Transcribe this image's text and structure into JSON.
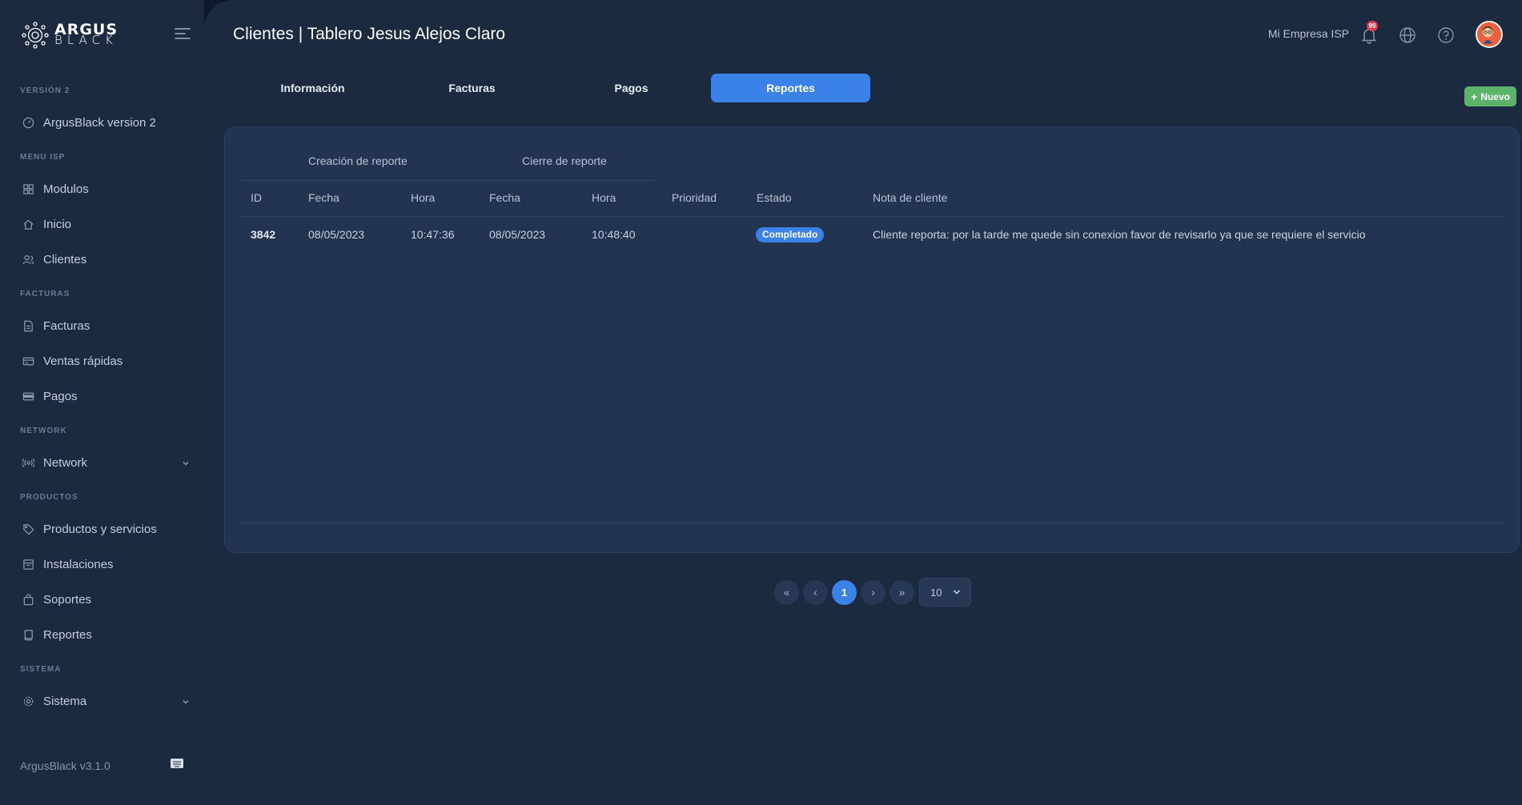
{
  "sidebar": {
    "logo": {
      "line1": "ARGUS",
      "line2": "BLACK"
    },
    "sections": [
      {
        "label": "VERSIÓN 2"
      },
      {
        "label": "MENU ISP"
      },
      {
        "label": "FACTURAS"
      },
      {
        "label": "NETWORK"
      },
      {
        "label": "PRODUCTOS"
      },
      {
        "label": "SISTEMA"
      }
    ],
    "items": [
      {
        "label": "ArgusBlack version 2",
        "icon": "gauge-icon"
      },
      {
        "label": "Modulos",
        "icon": "grid-icon"
      },
      {
        "label": "Inicio",
        "icon": "home-icon"
      },
      {
        "label": "Clientes",
        "icon": "users-icon"
      },
      {
        "label": "Facturas",
        "icon": "file-icon"
      },
      {
        "label": "Ventas rápidas",
        "icon": "card-icon"
      },
      {
        "label": "Pagos",
        "icon": "wallet-icon"
      },
      {
        "label": "Network",
        "icon": "broadcast-icon"
      },
      {
        "label": "Productos y servicios",
        "icon": "tag-icon"
      },
      {
        "label": "Instalaciones",
        "icon": "archive-icon"
      },
      {
        "label": "Soportes",
        "icon": "bag-icon"
      },
      {
        "label": "Reportes",
        "icon": "book-icon"
      },
      {
        "label": "Sistema",
        "icon": "gear-icon"
      }
    ],
    "footer_version": "ArgusBlack v3.1.0"
  },
  "header": {
    "title": "Clientes | Tablero Jesus Alejos Claro",
    "company": "Mi Empresa ISP",
    "notifications_count": "99"
  },
  "tabs": [
    {
      "label": "Información",
      "active": false
    },
    {
      "label": "Facturas",
      "active": false
    },
    {
      "label": "Pagos",
      "active": false
    },
    {
      "label": "Reportes",
      "active": true
    }
  ],
  "new_button": "Nuevo",
  "table": {
    "groups": [
      "Creación de reporte",
      "Cierre de reporte"
    ],
    "columns": [
      "ID",
      "Fecha",
      "Hora",
      "Fecha",
      "Hora",
      "Prioridad",
      "Estado",
      "Nota de cliente"
    ],
    "rows": [
      {
        "id": "3842",
        "fecha_creacion": "08/05/2023",
        "hora_creacion": "10:47:36",
        "fecha_cierre": "08/05/2023",
        "hora_cierre": "10:48:40",
        "prioridad": "",
        "estado": "Completado",
        "nota": "Cliente reporta: por la tarde me quede sin conexion favor de revisarlo ya que se requiere el servicio"
      }
    ]
  },
  "pagination": {
    "first": "«",
    "prev": "‹",
    "current": "1",
    "next": "›",
    "last": "»",
    "page_size": "10"
  },
  "colors": {
    "accent": "#3b82e8",
    "success": "#5cb36a",
    "badge": "#e0384e"
  }
}
